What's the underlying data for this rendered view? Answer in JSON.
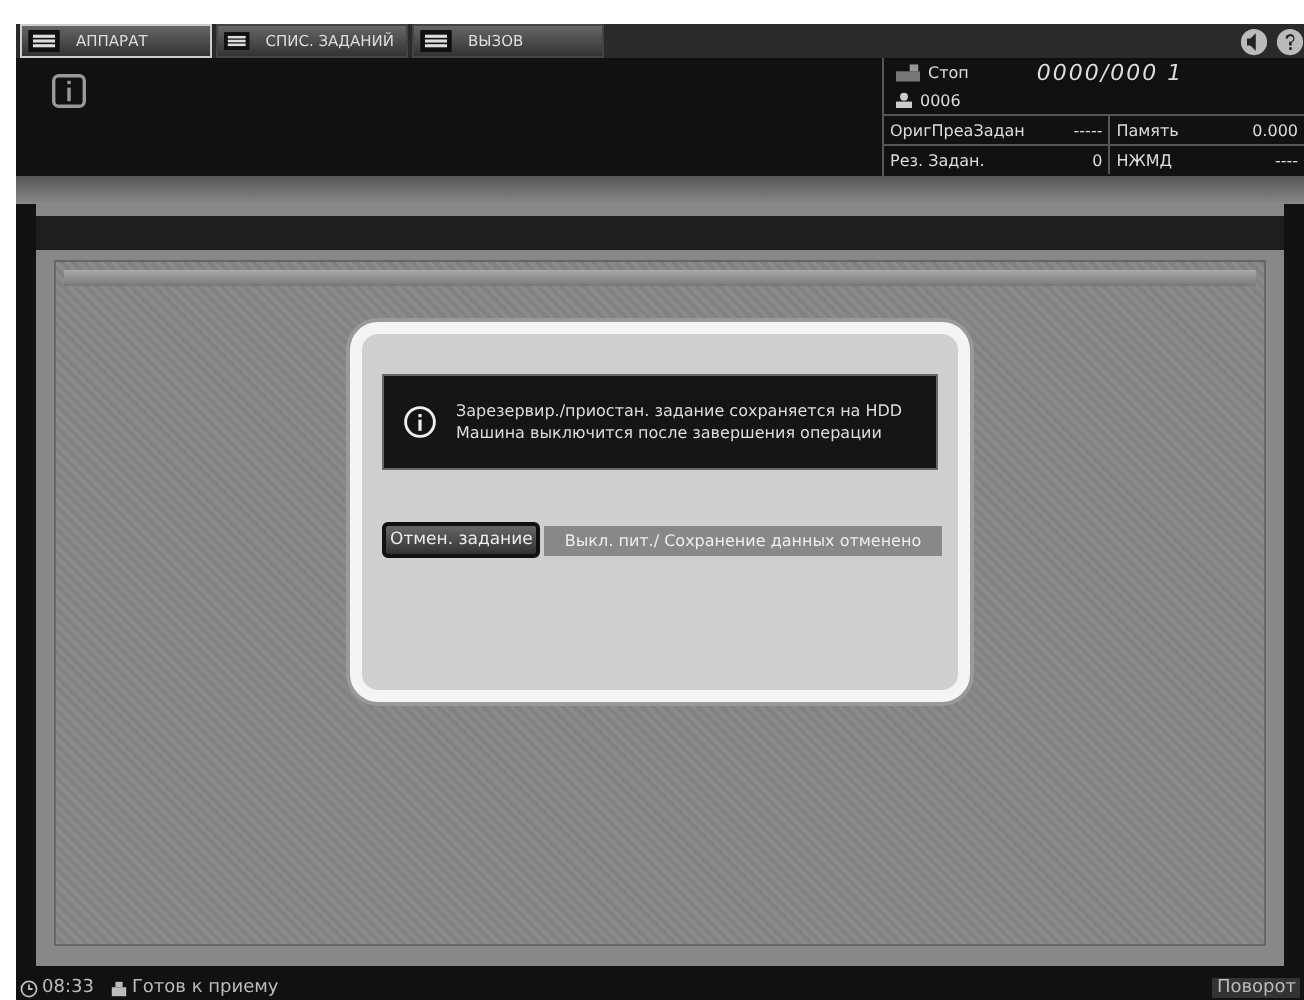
{
  "tabs": [
    {
      "label": "АППАРАТ",
      "selected": true
    },
    {
      "label": "СПИС. ЗАДАНИЙ",
      "selected": false
    },
    {
      "label": "ВЫЗОВ",
      "selected": false
    }
  ],
  "status": {
    "state": "Стоп",
    "counter": "0000/000 1",
    "user": "0006"
  },
  "info_rows": [
    {
      "label": "ОригПреаЗадан",
      "value": "-----",
      "label2": "Память",
      "value2": "0.000"
    },
    {
      "label": "Рез. Задан.",
      "value": "0",
      "label2": "НЖМД",
      "value2": "----"
    }
  ],
  "dialog": {
    "message": [
      "Зарезервир./приостан. задание сохраняется на HDD",
      "Машина выключится после завершения операции"
    ],
    "button": "Отмен. задание",
    "note": "Выкл. пит./ Сохранение данных отменено"
  },
  "status_bar": {
    "time": "08:33",
    "message": "Готов к приему",
    "right": "Поворот"
  }
}
